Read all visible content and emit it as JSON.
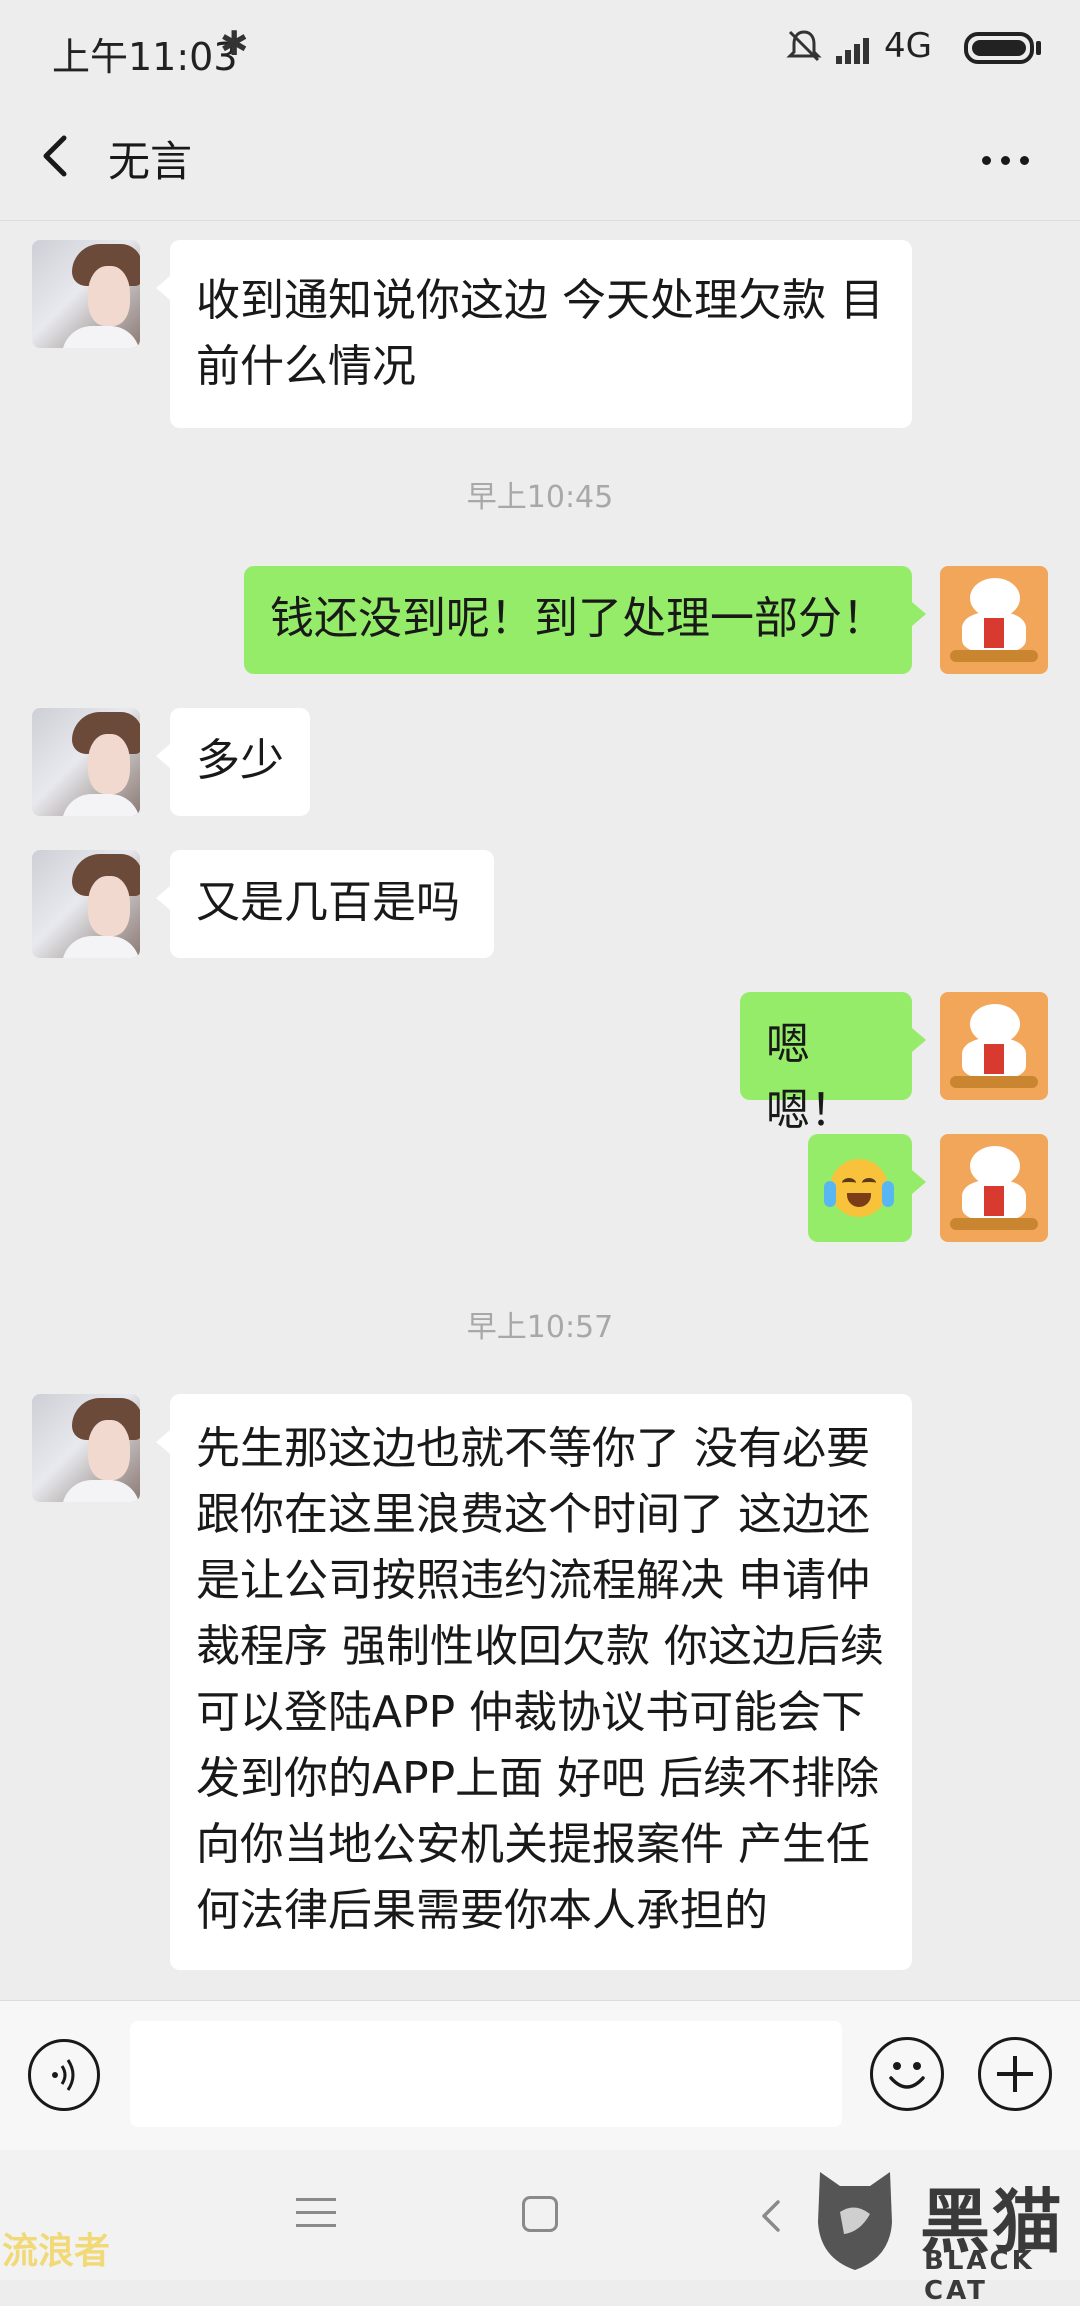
{
  "status_bar": {
    "time": "上午11:03",
    "network": "4G"
  },
  "header": {
    "title": "无言"
  },
  "messages": [
    {
      "sender": "contact",
      "text": "收到通知说你这边 今天处理欠款 目前什么情况"
    },
    {
      "type": "timestamp",
      "text": "早上10:45"
    },
    {
      "sender": "me",
      "text": "钱还没到呢！到了处理一部分！"
    },
    {
      "sender": "contact",
      "text": "多少"
    },
    {
      "sender": "contact",
      "text": "又是几百是吗"
    },
    {
      "sender": "me",
      "text": "嗯嗯！"
    },
    {
      "sender": "me",
      "emoji": "loudly-crying-face"
    },
    {
      "type": "timestamp",
      "text": "早上10:57"
    },
    {
      "sender": "contact",
      "text": "先生那这边也就不等你了 没有必要跟你在这里浪费这个时间了 这边还是让公司按照违约流程解决 申请仲裁程序 强制性收回欠款 你这边后续可以登陆APP 仲裁协议书可能会下发到你的APP上面 好吧 后续不排除向你当地公安机关提报案件 产生任何法律后果需要你本人承担的"
    }
  ],
  "input_bar": {
    "value": "",
    "placeholder": ""
  },
  "watermarks": {
    "left": "流浪者",
    "brand_cn": "黑猫",
    "brand_en": "BLACK CAT"
  },
  "colors": {
    "background": "#EDEDED",
    "bubble_in": "#FFFFFF",
    "bubble_out": "#95EC69",
    "timestamp": "#A8A8A8"
  },
  "icons": [
    "bluetooth-icon",
    "mute-icon",
    "signal-icon",
    "battery-icon",
    "back-icon",
    "more-icon",
    "voice-icon",
    "emoji-icon",
    "plus-icon",
    "menu-icon",
    "home-icon",
    "nav-back-icon"
  ]
}
